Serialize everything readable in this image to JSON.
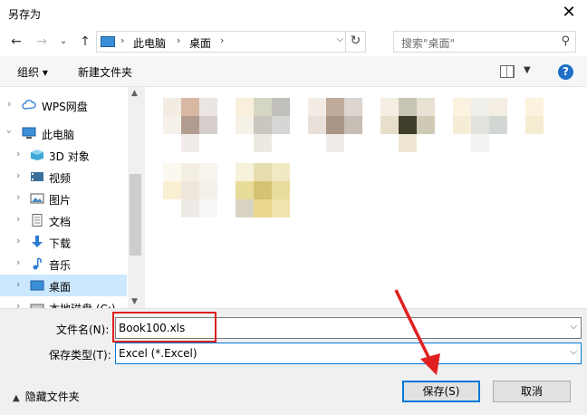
{
  "window": {
    "title": "另存为",
    "close": "✕"
  },
  "nav": {
    "back": "←",
    "forward": "→",
    "recent": "⌄",
    "up": "↑",
    "crumbs": [
      "此电脑",
      "桌面"
    ],
    "search_placeholder": "搜索\"桌面\""
  },
  "toolbar": {
    "organize": "组织 ▾",
    "new_folder": "新建文件夹",
    "help": "?"
  },
  "sidebar": {
    "items": [
      {
        "label": "WPS网盘",
        "icon": "cloud-icon"
      },
      {
        "label": "此电脑",
        "icon": "pc-icon"
      },
      {
        "label": "3D 对象",
        "icon": "3d-objects-icon"
      },
      {
        "label": "视频",
        "icon": "video-icon"
      },
      {
        "label": "图片",
        "icon": "pictures-icon"
      },
      {
        "label": "文档",
        "icon": "documents-icon"
      },
      {
        "label": "下载",
        "icon": "download-icon"
      },
      {
        "label": "音乐",
        "icon": "music-icon"
      },
      {
        "label": "桌面",
        "icon": "desktop-icon"
      },
      {
        "label": "本地磁盘 (C:)",
        "icon": "disk-icon"
      }
    ]
  },
  "form": {
    "filename_label": "文件名(N):",
    "filename_value": "Book100.xls",
    "filetype_label": "保存类型(T):",
    "filetype_value": "Excel (*.Excel)"
  },
  "footer": {
    "hide_folders": "隐藏文件夹",
    "save": "保存(S)",
    "cancel": "取消"
  },
  "colors": {
    "highlight": "#e02020",
    "selection": "#cce8ff",
    "accent": "#0078d7"
  }
}
